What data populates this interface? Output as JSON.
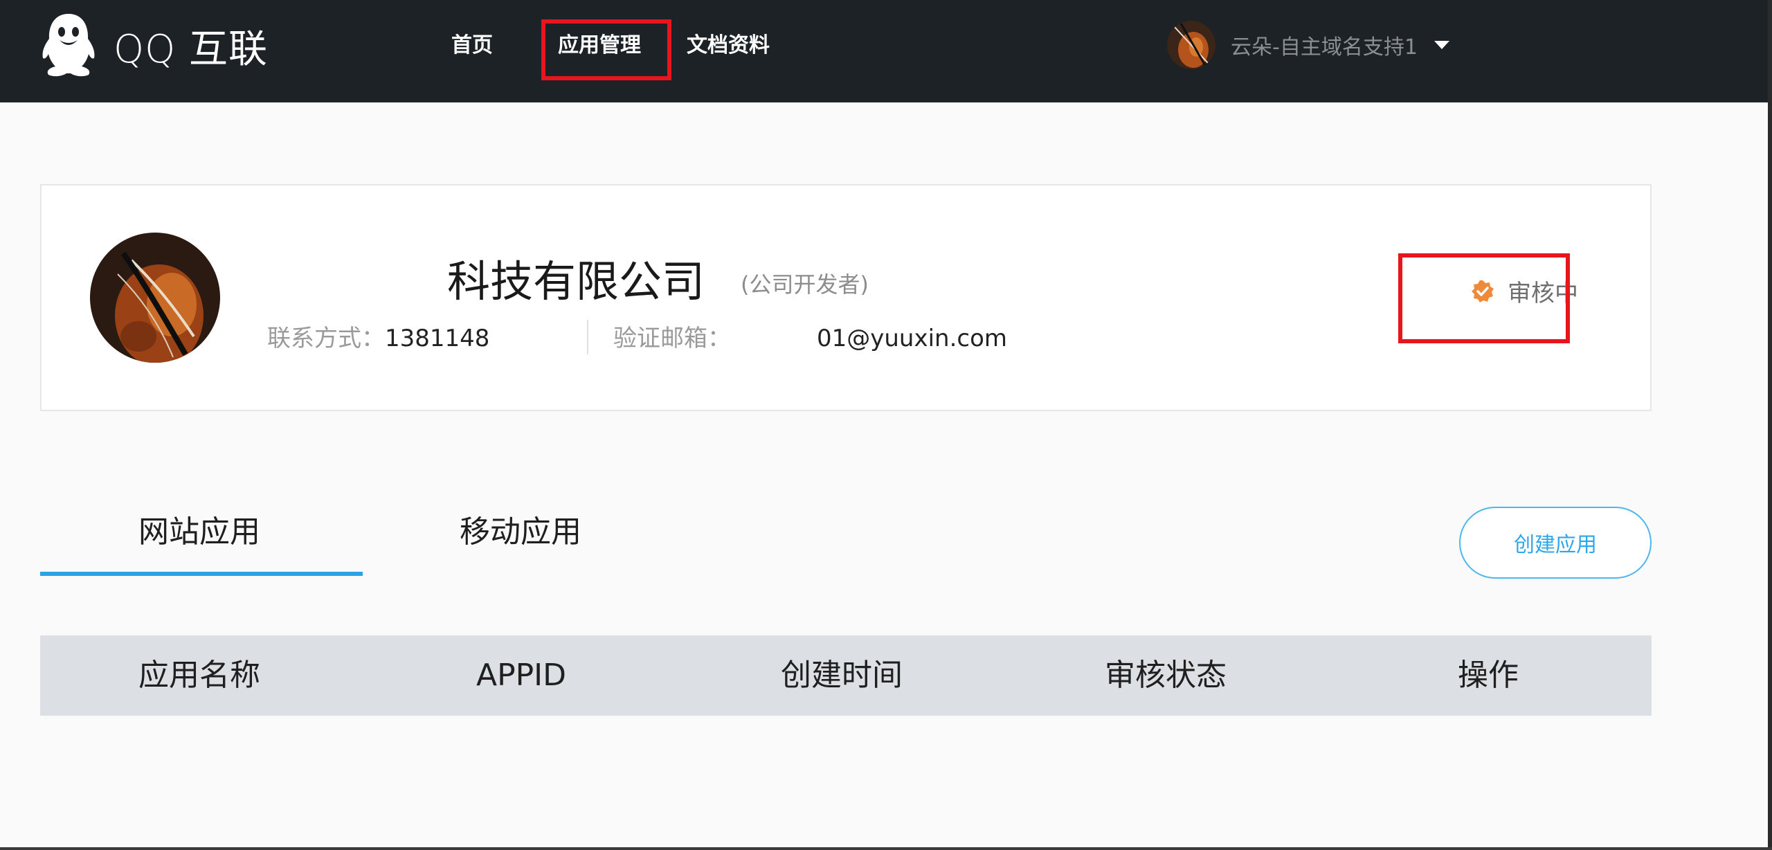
{
  "header": {
    "logo_text": "QQ 互联",
    "nav": [
      {
        "label": "首页"
      },
      {
        "label": "应用管理"
      },
      {
        "label": "文档资料"
      }
    ],
    "user_name": "云朵-自主域名支持1"
  },
  "profile": {
    "company_name": "科技有限公司",
    "developer_type": "(公司开发者)",
    "contact_label": "联系方式：",
    "contact_value": "1381148",
    "email_label": "验证邮箱：",
    "email_value": "01@yuuxin.com",
    "status_text": "审核中"
  },
  "tabs": [
    {
      "label": "网站应用",
      "active": true
    },
    {
      "label": "移动应用",
      "active": false
    }
  ],
  "create_button_label": "创建应用",
  "table": {
    "columns": [
      "应用名称",
      "APPID",
      "创建时间",
      "审核状态",
      "操作"
    ]
  },
  "colors": {
    "accent": "#2aa2e6",
    "highlight": "#e8151c",
    "status_badge": "#ef8a3a"
  }
}
